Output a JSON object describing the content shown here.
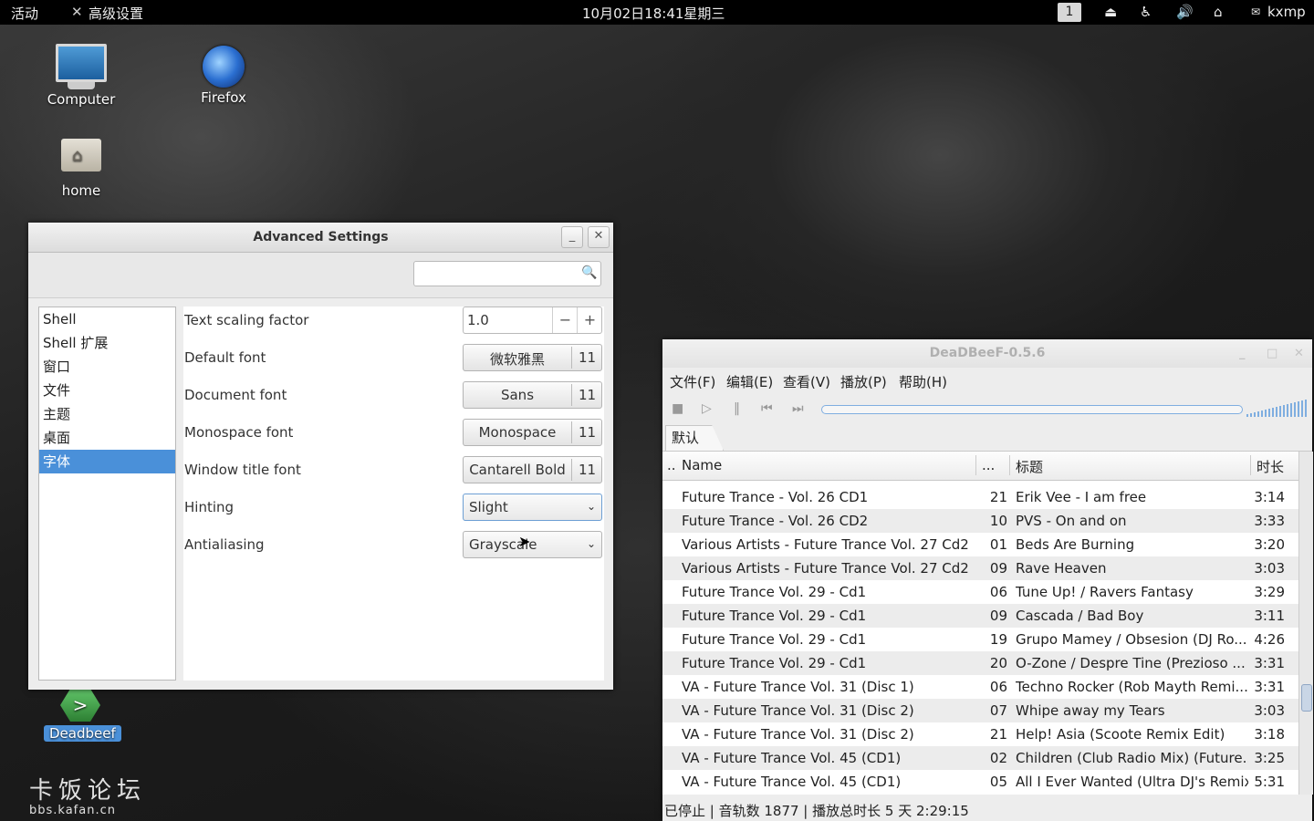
{
  "topbar": {
    "activities": "活动",
    "app_name": "高级设置",
    "clock": "10月02日18:41星期三",
    "workspace": "1",
    "user": "kxmp"
  },
  "desktop": {
    "icons": [
      {
        "label": "Computer"
      },
      {
        "label": "Firefox"
      },
      {
        "label": "home"
      },
      {
        "label": "Deadbeef"
      }
    ],
    "watermark_cn": "卡饭论坛",
    "watermark_url": "bbs.kafan.cn"
  },
  "advanced_settings": {
    "title": "Advanced Settings",
    "search_placeholder": "",
    "sidebar": [
      "Shell",
      "Shell 扩展",
      "窗口",
      "文件",
      "主题",
      "桌面",
      "字体"
    ],
    "selected": "字体",
    "text_scaling": {
      "label": "Text scaling factor",
      "value": "1.0"
    },
    "default_font": {
      "label": "Default font",
      "name": "微软雅黑",
      "size": "11"
    },
    "document_font": {
      "label": "Document font",
      "name": "Sans",
      "size": "11"
    },
    "monospace_font": {
      "label": "Monospace font",
      "name": "Monospace",
      "size": "11"
    },
    "window_title_font": {
      "label": "Window title font",
      "name": "Cantarell Bold",
      "size": "11"
    },
    "hinting": {
      "label": "Hinting",
      "value": "Slight"
    },
    "antialiasing": {
      "label": "Antialiasing",
      "value": "Grayscale"
    }
  },
  "deadbeef": {
    "title": "DeaDBeeF-0.5.6",
    "menu": [
      "文件(F)",
      "编辑(E)",
      "查看(V)",
      "播放(P)",
      "帮助(H)"
    ],
    "tab": "默认",
    "columns": {
      "indicator": "..",
      "name": "Name",
      "num": "...",
      "title": "标题",
      "duration": "时长"
    },
    "tracks": [
      {
        "name": "Future Trance - Vol. 26 CD1",
        "num": "21",
        "title": "Erik Vee - I am free",
        "dur": "3:14"
      },
      {
        "name": "Future Trance - Vol. 26 CD2",
        "num": "10",
        "title": "PVS - On and on",
        "dur": "3:33"
      },
      {
        "name": "Various Artists - Future Trance Vol. 27 Cd2",
        "num": "01",
        "title": "Beds Are Burning",
        "dur": "3:20"
      },
      {
        "name": "Various Artists - Future Trance Vol. 27 Cd2",
        "num": "09",
        "title": "Rave Heaven",
        "dur": "3:03"
      },
      {
        "name": "Future Trance Vol. 29 - Cd1",
        "num": "06",
        "title": "Tune Up! / Ravers Fantasy",
        "dur": "3:29"
      },
      {
        "name": "Future Trance Vol. 29 - Cd1",
        "num": "09",
        "title": "Cascada / Bad Boy",
        "dur": "3:11"
      },
      {
        "name": "Future Trance Vol. 29 - Cd1",
        "num": "19",
        "title": "Grupo Mamey / Obsesion (DJ Ro...",
        "dur": "4:26"
      },
      {
        "name": "Future Trance Vol. 29 - Cd1",
        "num": "20",
        "title": "O-Zone / Despre Tine (Prezioso ...",
        "dur": "3:31"
      },
      {
        "name": "VA - Future Trance Vol. 31 (Disc 1)",
        "num": "06",
        "title": "Techno Rocker (Rob Mayth Remi...",
        "dur": "3:31"
      },
      {
        "name": "VA - Future Trance Vol. 31 (Disc 2)",
        "num": "07",
        "title": "Whipe away my Tears",
        "dur": "3:03"
      },
      {
        "name": "VA - Future Trance Vol. 31 (Disc 2)",
        "num": "21",
        "title": "Help! Asia (Scoote Remix Edit)",
        "dur": "3:18"
      },
      {
        "name": "VA - Future Trance Vol. 45 (CD1)",
        "num": "02",
        "title": "Children (Club Radio Mix) (Future...",
        "dur": "3:25"
      },
      {
        "name": "VA - Future Trance Vol. 45 (CD1)",
        "num": "05",
        "title": "All I Ever Wanted (Ultra DJ's Remix)",
        "dur": "5:31"
      }
    ],
    "status": "已停止 | 音轨数 1877 | 播放总时长 5 天 2:29:15"
  }
}
